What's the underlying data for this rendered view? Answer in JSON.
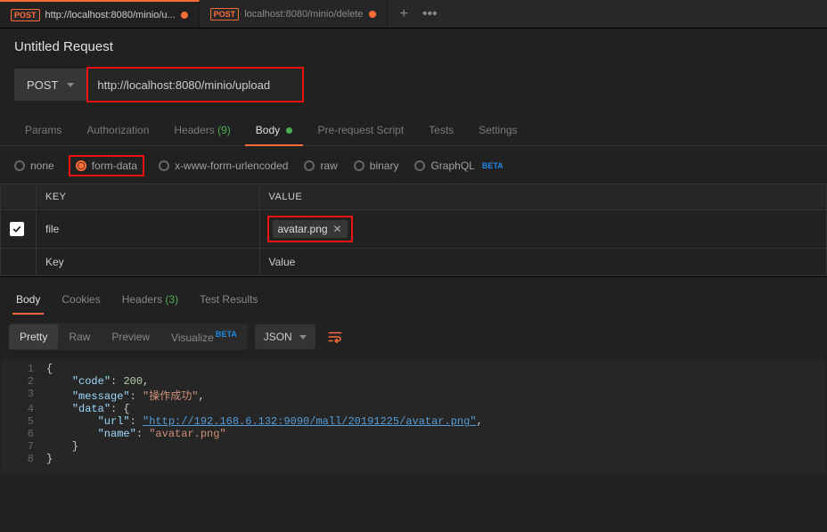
{
  "tabs": [
    {
      "method": "POST",
      "label": "http://localhost:8080/minio/u...",
      "dirty": true
    },
    {
      "method": "POST",
      "label": "localhost:8080/minio/delete",
      "dirty": true
    }
  ],
  "request": {
    "title": "Untitled Request",
    "method": "POST",
    "url": "http://localhost:8080/minio/upload"
  },
  "req_tabs": {
    "params": "Params",
    "authorization": "Authorization",
    "headers": "Headers",
    "headers_count": "(9)",
    "body": "Body",
    "prerequest": "Pre-request Script",
    "tests": "Tests",
    "settings": "Settings"
  },
  "body_types": {
    "none": "none",
    "formdata": "form-data",
    "urlencoded": "x-www-form-urlencoded",
    "raw": "raw",
    "binary": "binary",
    "graphql": "GraphQL",
    "beta": "BETA"
  },
  "kv": {
    "key_header": "KEY",
    "value_header": "VALUE",
    "rows": [
      {
        "key": "file",
        "value": "avatar.png"
      }
    ],
    "key_placeholder": "Key",
    "value_placeholder": "Value"
  },
  "resp_tabs": {
    "body": "Body",
    "cookies": "Cookies",
    "headers": "Headers",
    "headers_count": "(3)",
    "test_results": "Test Results"
  },
  "view_bar": {
    "pretty": "Pretty",
    "raw": "Raw",
    "preview": "Preview",
    "visualize": "Visualize",
    "beta": "BETA",
    "lang": "JSON"
  },
  "response_json": {
    "code": 200,
    "message": "操作成功",
    "data": {
      "url": "http://192.168.6.132:9090/mall/20191225/avatar.png",
      "name": "avatar.png"
    }
  }
}
